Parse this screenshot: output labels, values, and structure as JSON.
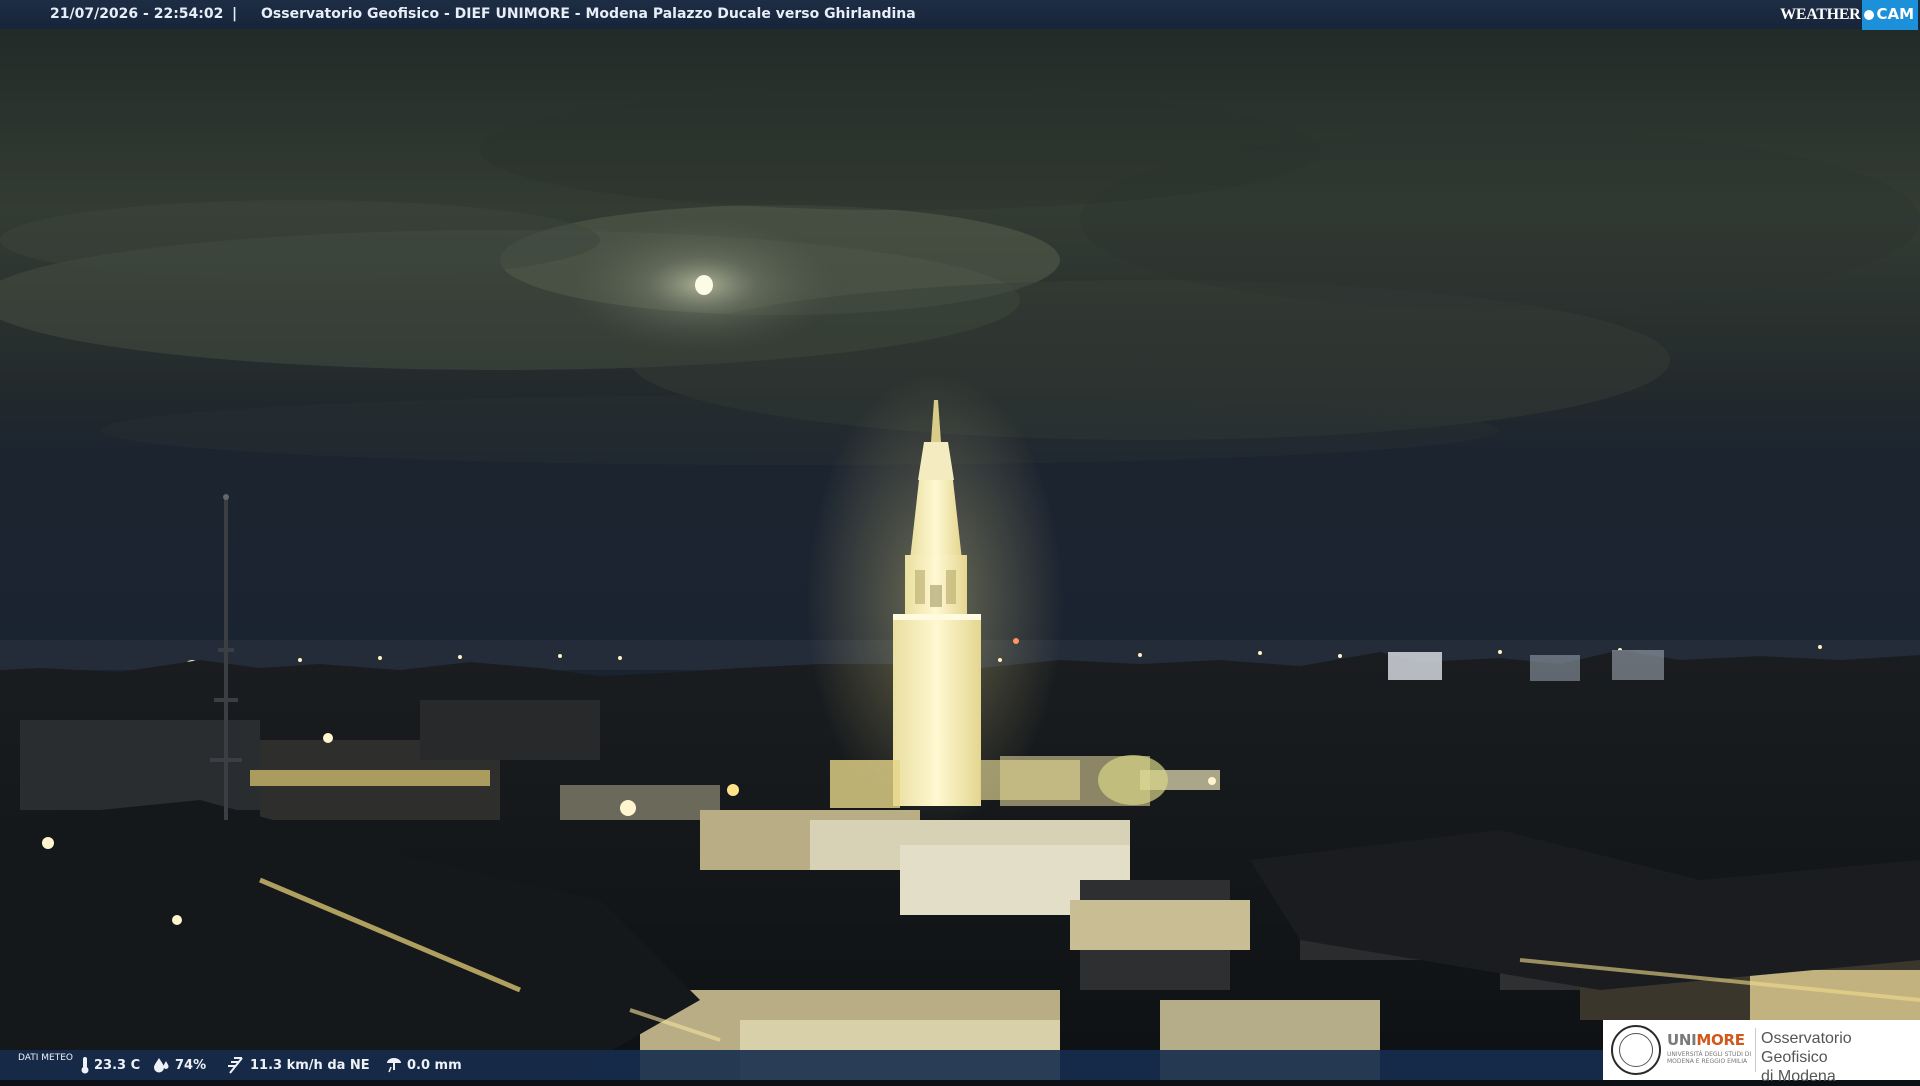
{
  "header": {
    "datetime": "21/07/2026 - 22:54:02",
    "separator": "|",
    "title": "Osservatorio Geofisico - DIEF UNIMORE - Modena Palazzo Ducale verso Ghirlandina",
    "brand_weather": "WEATHER",
    "brand_cam": "CAM"
  },
  "weather_bar": {
    "label": "DATI METEO",
    "temperature": "23.3 C",
    "humidity": "74%",
    "wind": "11.3 km/h da NE",
    "rain": "0.0 mm"
  },
  "logo": {
    "university": "UNIMORE",
    "university_sub": "UNIVERSITÀ DEGLI STUDI DI MODENA E REGGIO EMILIA",
    "observatory_line1": "Osservatorio Geofisico",
    "observatory_line2": "di Modena"
  },
  "colors": {
    "bar": "#17253a",
    "cam_accent": "#1c90d8",
    "unimore_orange": "#d2571b",
    "sky": "#2a332d",
    "tower_light": "#fff6c8"
  },
  "icons": [
    "thermometer-icon",
    "humidity-icon",
    "wind-icon",
    "rain-gauge-icon"
  ]
}
